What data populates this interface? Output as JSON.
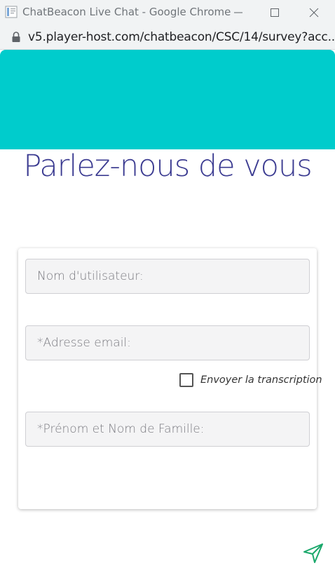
{
  "window": {
    "title": "ChatBeacon Live Chat - Google Chrome",
    "app_icon": "page-icon",
    "controls": [
      "minimize-icon",
      "maximize-icon",
      "close-icon"
    ]
  },
  "addressbar": {
    "url": "v5.player-host.com/chatbeacon/CSC/14/survey?acc...",
    "lock_icon": "lock-icon"
  },
  "colors": {
    "header": "#00cccc",
    "heading": "#3b3b91",
    "send_icon": "#1aa86b"
  },
  "form": {
    "heading": "Parlez-nous de vous",
    "username_placeholder": "Nom d'utilisateur:",
    "email_placeholder": "*Adresse email:",
    "transcript_label": "Envoyer la transcription",
    "transcript_checked": false,
    "fullname_placeholder": "*Prénom et Nom de Famille:"
  },
  "send": {
    "icon": "send-icon"
  }
}
